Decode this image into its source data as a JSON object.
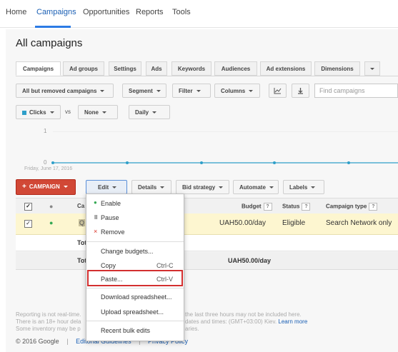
{
  "topnav": {
    "items": [
      "Home",
      "Campaigns",
      "Opportunities",
      "Reports",
      "Tools"
    ],
    "active": "Campaigns"
  },
  "page": {
    "title": "All campaigns"
  },
  "tabs": [
    "Campaigns",
    "Ad groups",
    "Settings",
    "Ads",
    "Keywords",
    "Audiences",
    "Ad extensions",
    "Dimensions"
  ],
  "toolbar": {
    "filter_dropdown": "All but removed campaigns",
    "segment": "Segment",
    "filter": "Filter",
    "columns": "Columns",
    "search_placeholder": "Find campaigns"
  },
  "chart_controls": {
    "metric1": "Clicks",
    "vs": "vs",
    "metric2": "None",
    "period": "Daily"
  },
  "chart": {
    "y_top": "1",
    "y_bottom": "0",
    "date_label": "Friday, June 17, 2016",
    "line_color": "#2e9fc9"
  },
  "actions": {
    "campaign_button": "CAMPAIGN",
    "edit": "Edit",
    "details": "Details",
    "bid_strategy": "Bid strategy",
    "automate": "Automate",
    "labels": "Labels"
  },
  "table": {
    "headers": {
      "campaign": "Ca",
      "budget": "Budget",
      "status": "Status",
      "campaign_type": "Campaign type"
    },
    "row": {
      "campaign_prefix": "Q",
      "budget": "UAH50.00/day",
      "status": "Eligible",
      "campaign_type": "Search Network only"
    },
    "total_row1": "Tot",
    "total_row2": "Tot",
    "total_budget": "UAH50.00/day"
  },
  "menu": {
    "enable": "Enable",
    "pause": "Pause",
    "remove": "Remove",
    "change_budgets": "Change budgets...",
    "copy": "Copy",
    "copy_shortcut": "Ctrl-C",
    "paste": "Paste...",
    "paste_shortcut": "Ctrl-V",
    "download": "Download spreadsheet...",
    "upload": "Upload spreadsheet...",
    "recent": "Recent bulk edits"
  },
  "footer": {
    "line1_left": "Reporting is not real-time.",
    "line1_right": "the last three hours may not be included here.",
    "line2_left": "There is an 18+ hour dela",
    "line2_right": "dates and times: (GMT+03:00) Kiev.",
    "learn_more": "Learn more",
    "line3_left": "Some inventory may be p",
    "line3_right": "aries.",
    "copyright": "© 2016 Google",
    "sep": "|",
    "guidelines": "Editorial Guidelines",
    "privacy": "Privacy Policy"
  }
}
